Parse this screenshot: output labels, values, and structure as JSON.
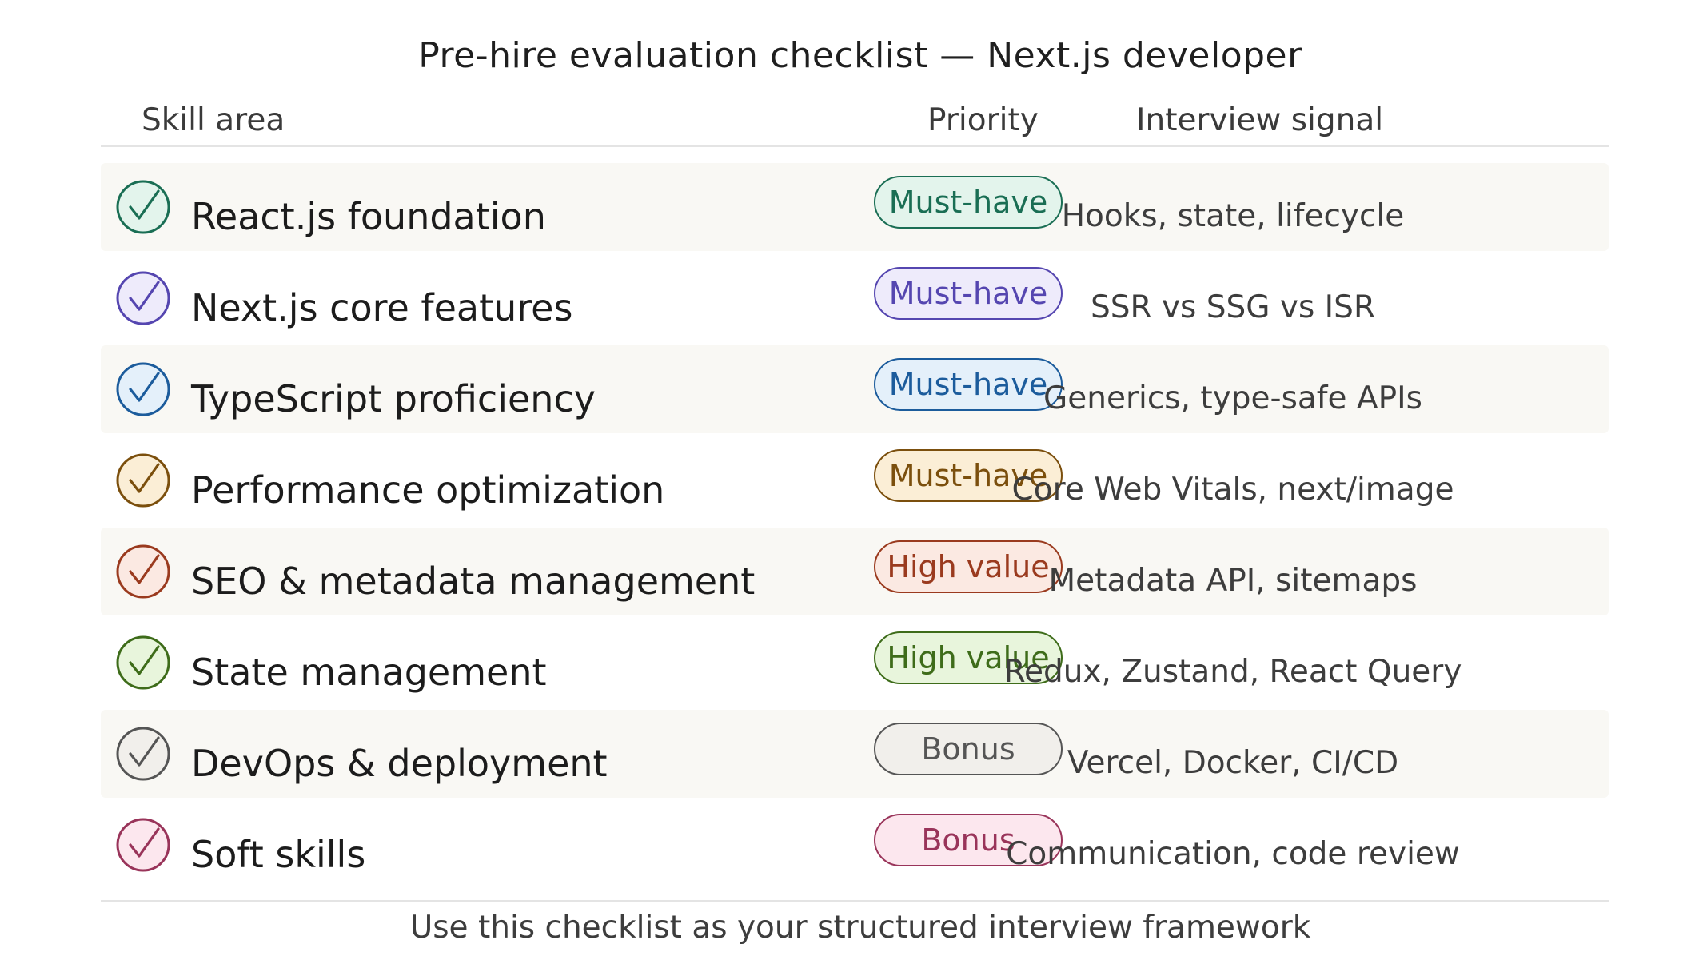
{
  "title": "Pre-hire evaluation checklist — Next.js developer",
  "headers": {
    "skill": "Skill area",
    "priority": "Priority",
    "signal": "Interview signal"
  },
  "rows": [
    {
      "skill": "React.js foundation",
      "priority": "Must-have",
      "signal": "Hooks, state, lifecycle",
      "icon": "check-circle-icon",
      "color": "#1a6e54",
      "pill_bg": "#e3f4ec"
    },
    {
      "skill": "Next.js core features",
      "priority": "Must-have",
      "signal": "SSR vs SSG vs ISR",
      "icon": "check-circle-icon",
      "color": "#5546b0",
      "pill_bg": "#eeebfb"
    },
    {
      "skill": "TypeScript proficiency",
      "priority": "Must-have",
      "signal": "Generics, type-safe APIs",
      "icon": "check-circle-icon",
      "color": "#1c5c9c",
      "pill_bg": "#e4f0fa"
    },
    {
      "skill": "Performance optimization",
      "priority": "Must-have",
      "signal": "Core Web Vitals, next/image",
      "icon": "check-circle-icon",
      "color": "#7b4f0d",
      "pill_bg": "#fbeed6"
    },
    {
      "skill": "SEO & metadata management",
      "priority": "High value",
      "signal": "Metadata API, sitemaps",
      "icon": "check-circle-icon",
      "color": "#9a3a1e",
      "pill_bg": "#fbe9e2"
    },
    {
      "skill": "State management",
      "priority": "High value",
      "signal": "Redux, Zustand, React Query",
      "icon": "check-circle-icon",
      "color": "#3e6c1a",
      "pill_bg": "#e8f5dc"
    },
    {
      "skill": "DevOps & deployment",
      "priority": "Bonus",
      "signal": "Vercel, Docker, CI/CD",
      "icon": "check-circle-icon",
      "color": "#555555",
      "pill_bg": "#f1efeb"
    },
    {
      "skill": "Soft skills",
      "priority": "Bonus",
      "signal": "Communication, code review",
      "icon": "check-circle-icon",
      "color": "#99345a",
      "pill_bg": "#fce7ee"
    }
  ],
  "footer": "Use this checklist as your structured interview framework"
}
